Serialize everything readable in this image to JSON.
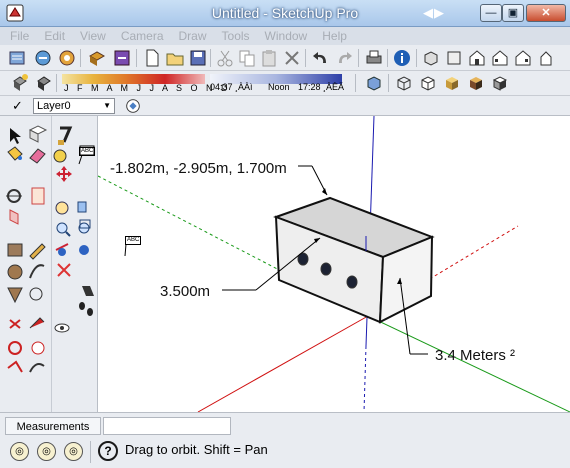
{
  "window": {
    "title": "Untitled - SketchUp Pro",
    "nav_arrows": "◀▶",
    "minimize": "—",
    "restore": "▣",
    "close": "✕"
  },
  "menu": [
    "File",
    "Edit",
    "View",
    "Camera",
    "Draw",
    "Tools",
    "Window",
    "Help"
  ],
  "shadow": {
    "months": "J F M A M J J A S O N D",
    "time_start": "04:37 ¸ÀÀì",
    "noon": "Noon",
    "time_end": "17:28 ¸ÀÈÄ"
  },
  "layer": {
    "check": "✓",
    "current": "Layer0"
  },
  "viewport": {
    "coord_label": "-1.802m, -2.905m, 1.700m",
    "length_label": "3.500m",
    "area_label": "3.4 Meters ²",
    "text_tool_tag": "ABC",
    "text_tool_tag2": "ABC"
  },
  "measurements": {
    "label": "Measurements",
    "value": ""
  },
  "status": {
    "help_symbol": "?",
    "message": "Drag to orbit.  Shift = Pan"
  },
  "colors": {
    "x_axis": "#d01010",
    "y_axis": "#1a9a1a",
    "z_axis": "#1a1ab0",
    "box_top": "#d6d6d6",
    "box_side": "#efefef",
    "title_bar": "#a9c7ea"
  }
}
